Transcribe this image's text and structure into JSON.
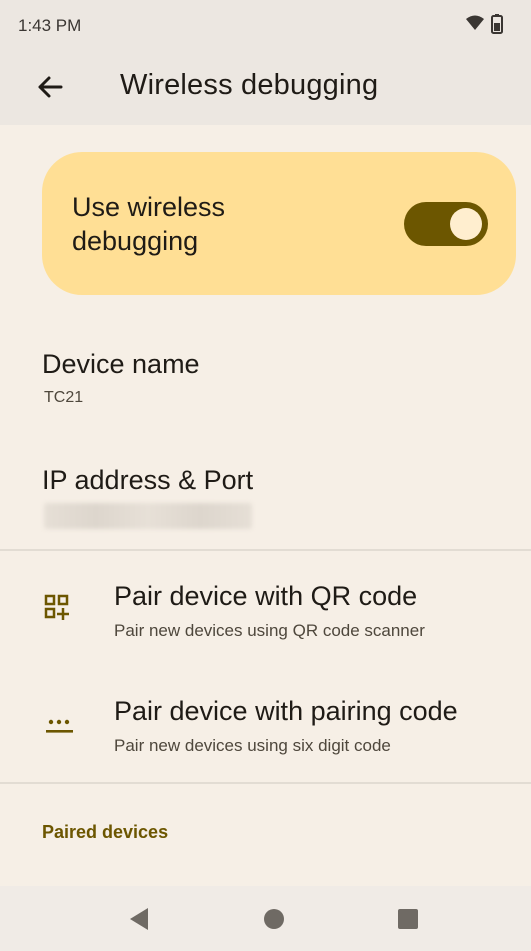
{
  "status_bar": {
    "time": "1:43 PM",
    "icons": [
      "wifi-icon",
      "battery-icon"
    ]
  },
  "app_bar": {
    "back_icon": "arrow-back-icon",
    "title": "Wireless debugging"
  },
  "main_switch": {
    "label": "Use wireless debugging",
    "checked": true,
    "colors": {
      "card": "#ffdf95",
      "track": "#6c5600",
      "thumb": "#ffeecf"
    }
  },
  "device_name": {
    "title": "Device name",
    "value": "TC21"
  },
  "ip_address": {
    "title": "IP address & Port",
    "value_blurred": true
  },
  "pair_qr": {
    "icon": "qr-code-scanner-icon",
    "title": "Pair device with QR code",
    "summary": "Pair new devices using QR code scanner"
  },
  "pair_code": {
    "icon": "dialpad-icon",
    "title": "Pair device with pairing code",
    "summary": "Pair new devices using six digit code"
  },
  "paired_devices": {
    "title": "Paired devices"
  },
  "nav_bar": {
    "buttons": [
      "back-triangle-icon",
      "home-circle-icon",
      "recents-square-icon"
    ]
  },
  "colors": {
    "accent": "#6c5600",
    "background": "#f6efe6",
    "app_bar": "#ece7e1"
  }
}
